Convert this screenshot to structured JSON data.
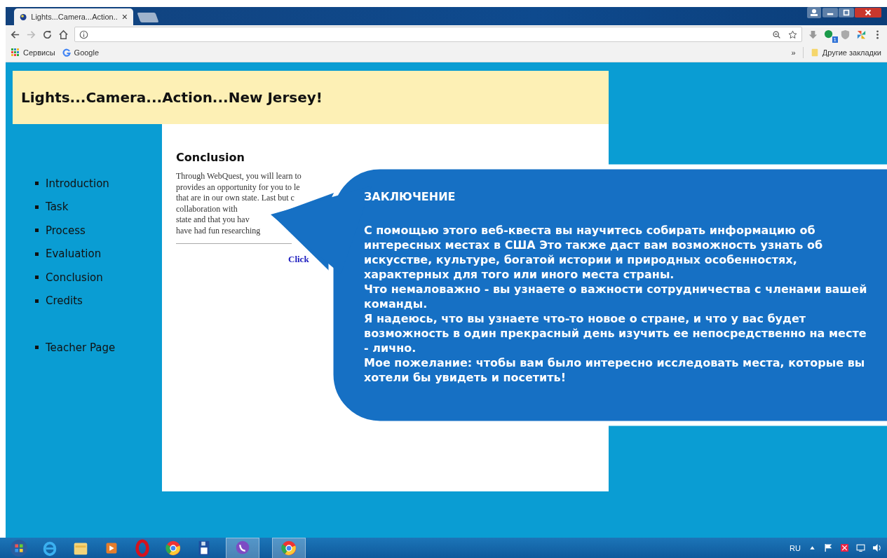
{
  "browser": {
    "tab": {
      "title": "Lights...Camera...Action..",
      "close": "×"
    },
    "bookmarks": [
      {
        "label": "Сервисы",
        "kind": "apps"
      },
      {
        "label": "Google",
        "kind": "google"
      }
    ],
    "overflow": "»",
    "other_bookmarks": "Другие закладки",
    "extension_badge": "1"
  },
  "page": {
    "title": "Lights...Camera...Action...New Jersey!",
    "nav": [
      "Introduction",
      "Task",
      "Process",
      "Evaluation",
      "Conclusion",
      "Credits"
    ],
    "nav_extra": [
      "Teacher Page"
    ],
    "heading": "Conclusion",
    "body_lines": [
      "Through WebQuest, you will learn to",
      "provides an opportunity for you to le",
      "that are in our own state. Last but c",
      "collaboration with",
      "state and that you hav",
      "have had fun researching"
    ],
    "link": "Click"
  },
  "bubble": {
    "heading": "ЗАКЛЮЧЕНИЕ",
    "paragraphs": [
      "С помощью этого веб-квеста вы научитесь собирать информацию об интересных местах в США Это также даст вам возможность узнать об искусстве, культуре, богатой истории и природных особенностях, характерных для того или иного места страны.",
      "Что немаловажно -  вы узнаете о важности сотрудничества с членами вашей команды.",
      "Я надеюсь, что вы узнаете что-то новое о стране, и  что у вас будет возможность в один прекрасный день изучить ее непосредственно на месте - лично.",
      "Мое пожелание: чтобы вам было интересно исследовать места, которые вы хотели бы увидеть и посетить!"
    ]
  },
  "taskbar": {
    "language": "RU"
  }
}
